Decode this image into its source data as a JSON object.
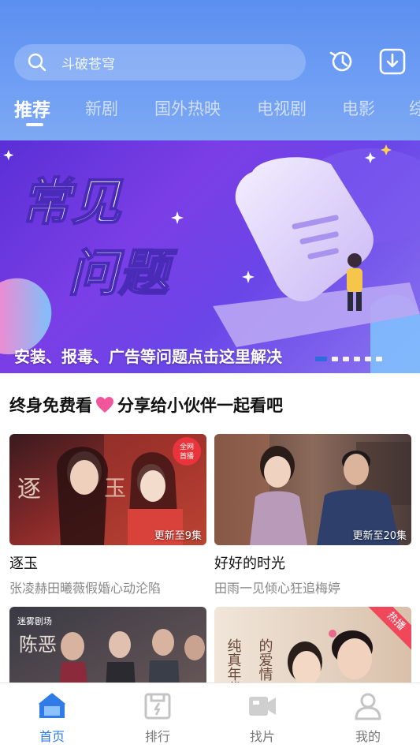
{
  "search": {
    "placeholder_text": "斗破苍穹"
  },
  "header": {
    "icons": [
      "history-icon",
      "download-icon"
    ]
  },
  "tabs": [
    {
      "label": "推荐",
      "active": true
    },
    {
      "label": "新剧"
    },
    {
      "label": "国外热映"
    },
    {
      "label": "电视剧"
    },
    {
      "label": "电影"
    },
    {
      "label": "综"
    }
  ],
  "banner": {
    "headline_line1": "常见",
    "headline_line2": "问题",
    "caption": "安装、报毒、广告等问题点击这里解决",
    "page_count": 6,
    "active_index": 0
  },
  "section": {
    "title_left": "终身免费看",
    "title_right": "分享给小伙伴一起看吧"
  },
  "cards": [
    {
      "title": "逐玉",
      "subtitle": "张凌赫田曦薇假婚心动沦陷",
      "episode": "更新至9集",
      "badge": "全网首播"
    },
    {
      "title": "好好的时光",
      "subtitle": "田雨一见倾心狂追梅婷",
      "episode": "更新至20集"
    },
    {
      "title": "",
      "subtitle": "",
      "poster_text": "迷雾剧场 · 陈恶"
    },
    {
      "title": "",
      "subtitle": "",
      "poster_text": "纯真年代的爱情",
      "tag": "热播"
    }
  ],
  "bottom_nav": [
    {
      "label": "首页",
      "icon": "home-icon",
      "active": true
    },
    {
      "label": "排行",
      "icon": "ranking-icon"
    },
    {
      "label": "找片",
      "icon": "video-camera-icon"
    },
    {
      "label": "我的",
      "icon": "user-icon"
    }
  ],
  "colors": {
    "header_top": "#5b8ff0",
    "active_blue": "#2f7ce8",
    "heart": "#f0579a",
    "hot_tag": "#f0475a"
  }
}
